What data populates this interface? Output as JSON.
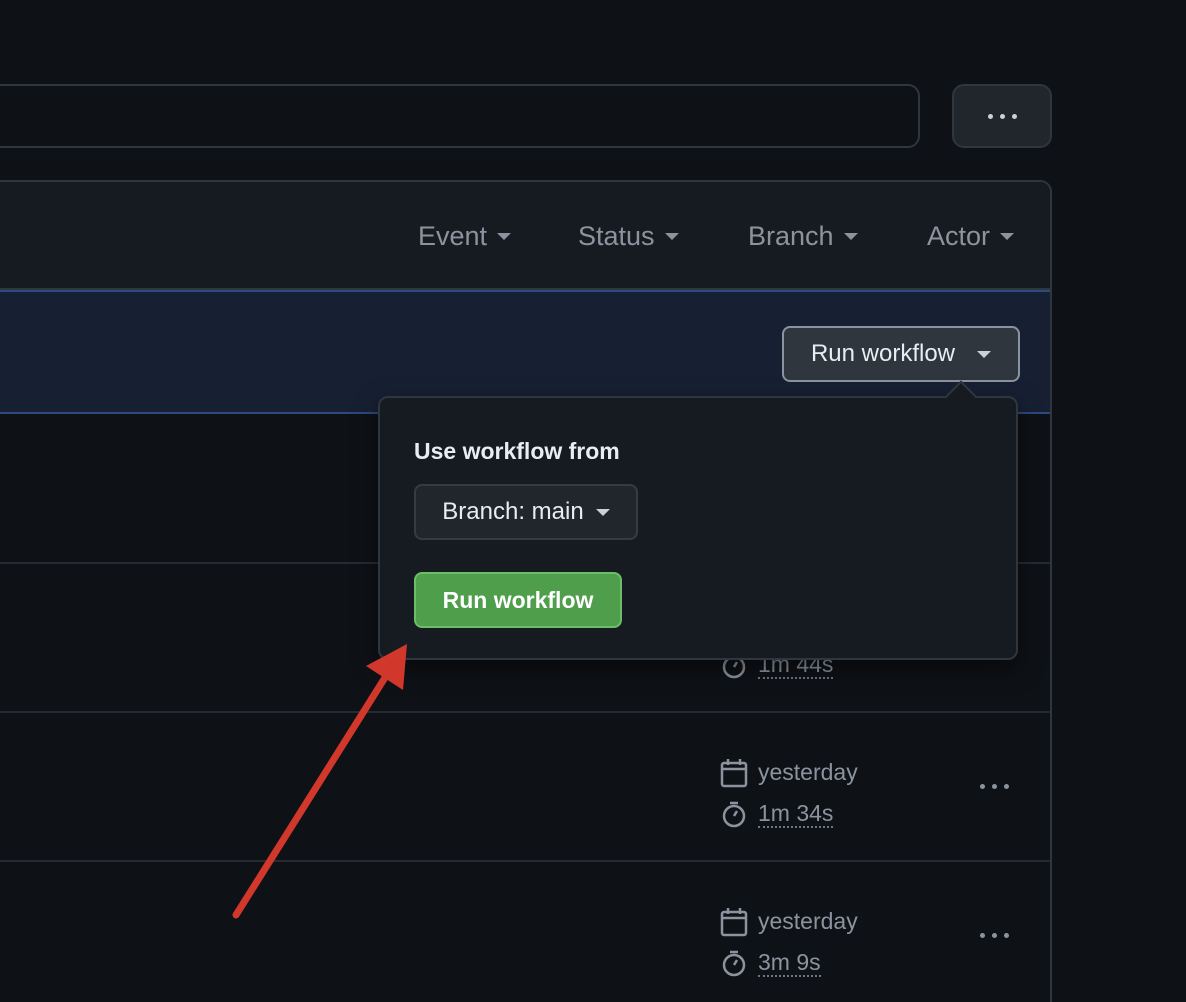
{
  "filters": [
    {
      "label": "Event"
    },
    {
      "label": "Status"
    },
    {
      "label": "Branch"
    },
    {
      "label": "Actor"
    }
  ],
  "banner": {
    "run_workflow_label": "Run workflow"
  },
  "dropdown": {
    "title": "Use workflow from",
    "branch_label": "Branch: main",
    "run_label": "Run workflow"
  },
  "runs": [
    {
      "date": "",
      "duration": "1m 44s"
    },
    {
      "date": "yesterday",
      "duration": "1m 34s"
    },
    {
      "date": "yesterday",
      "duration": "3m 9s"
    }
  ],
  "colors": {
    "background": "#0e1116",
    "banner": "#172033",
    "run_button": "#4f9e4c",
    "annotation_arrow": "#d1372b"
  },
  "icons": [
    "kebab-icon",
    "caret-down-icon",
    "calendar-icon",
    "stopwatch-icon"
  ]
}
